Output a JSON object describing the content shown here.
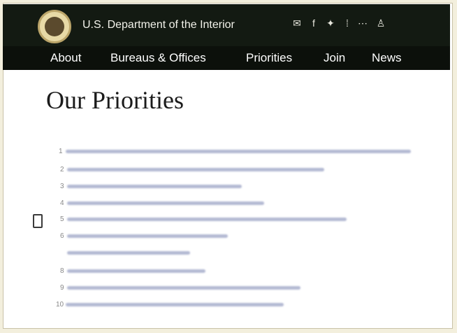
{
  "header": {
    "title": "U.S. Department of the Interior",
    "social_icons": [
      "email-icon",
      "facebook-icon",
      "twitter-icon",
      "flickr-icon",
      "more-icon",
      "person-icon"
    ]
  },
  "nav": {
    "items": [
      "About",
      "Bureaus & Offices",
      "Priorities",
      "Join",
      "News"
    ]
  },
  "main": {
    "title": "Our Priorities"
  },
  "colors": {
    "header_bg": "#131a12",
    "nav_bg": "#0c100b",
    "link": "#3a4a9a"
  }
}
